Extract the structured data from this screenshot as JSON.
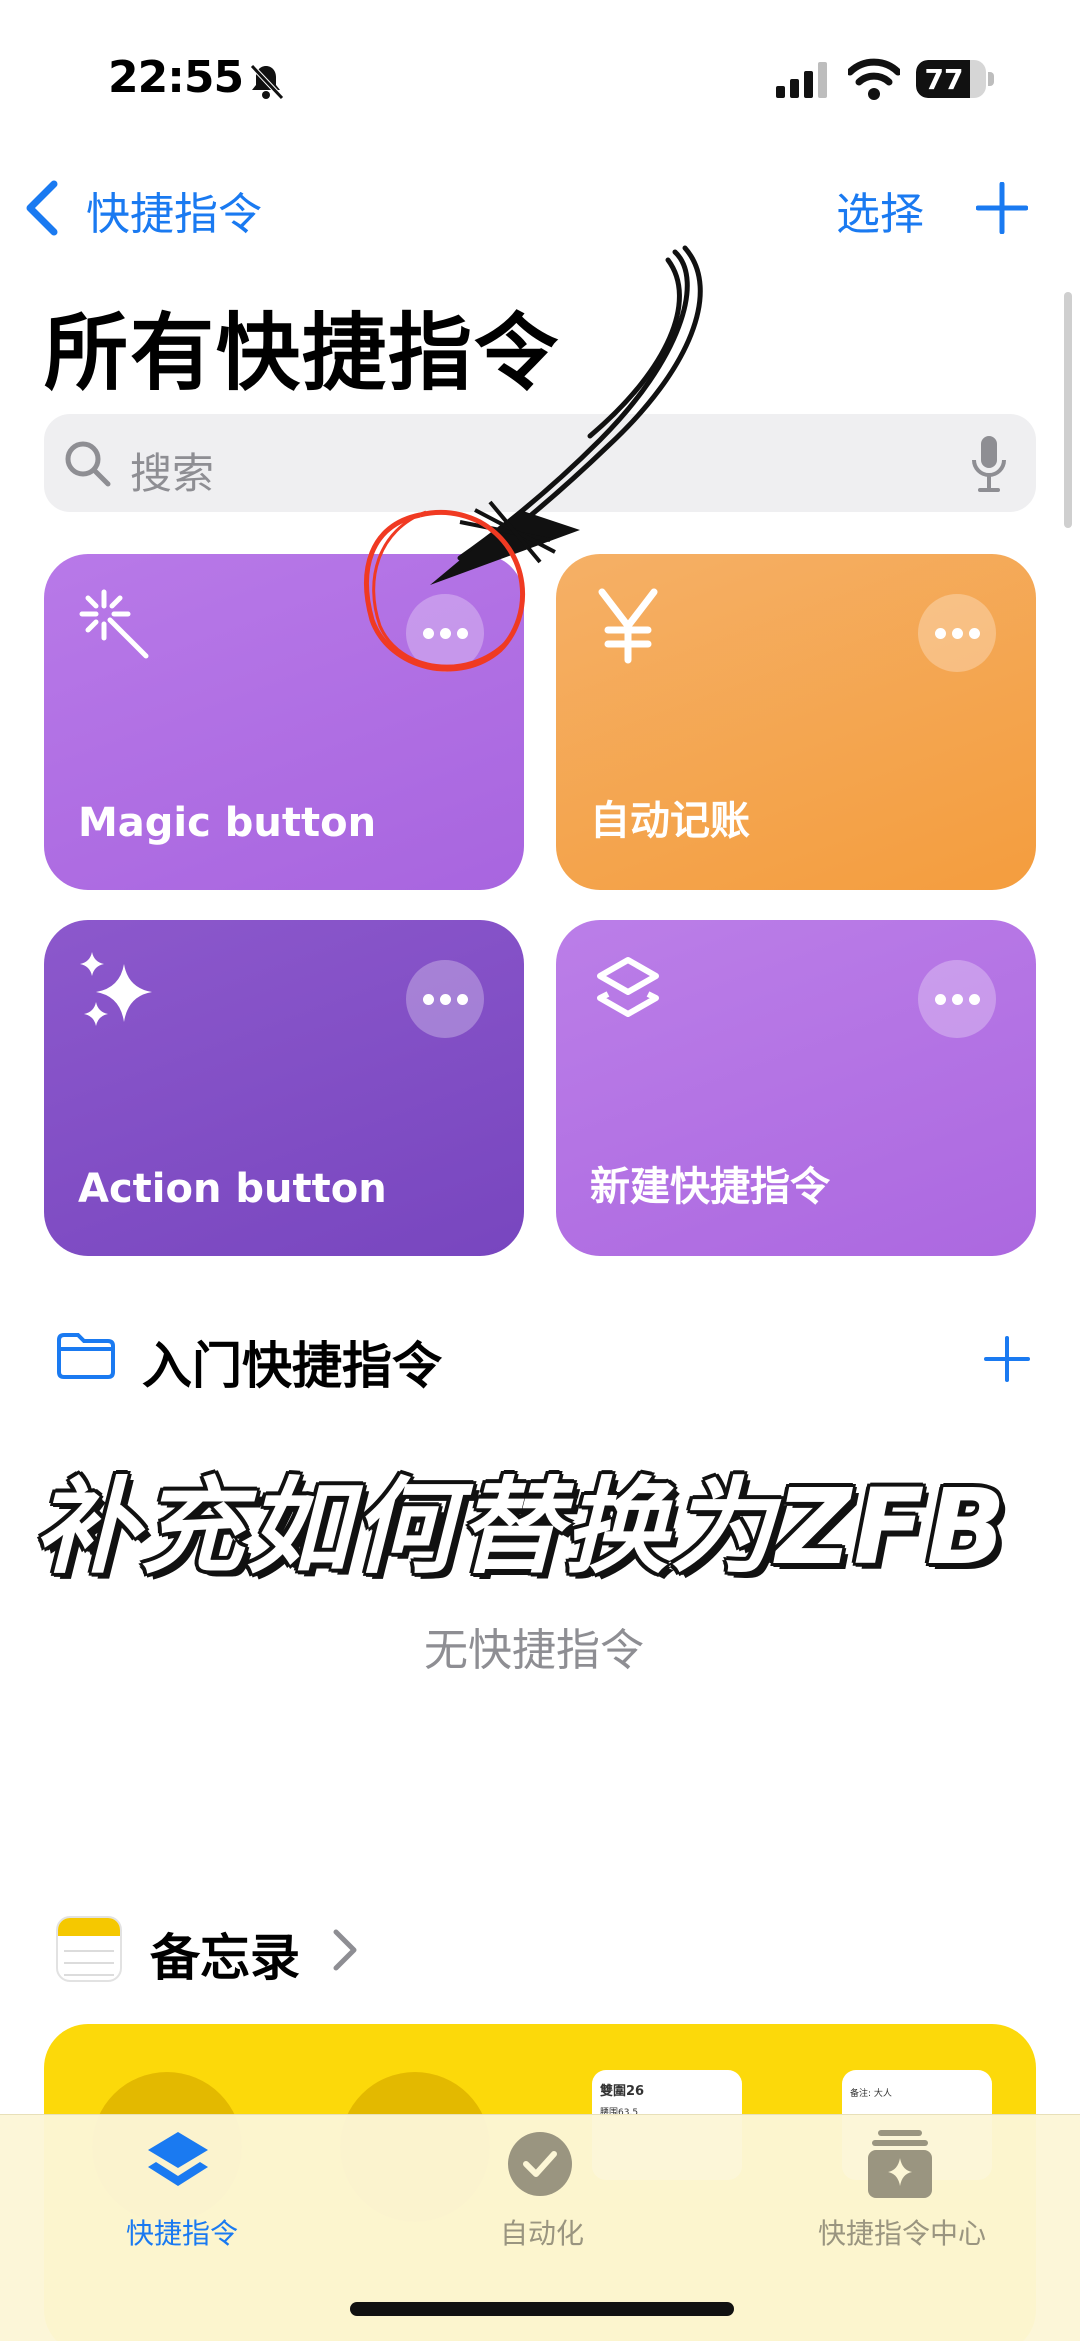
{
  "status_bar": {
    "time": "22:55",
    "battery": "77",
    "battery_level": 0.77
  },
  "nav": {
    "back_label": "快捷指令",
    "select_label": "选择"
  },
  "page": {
    "title": "所有快捷指令"
  },
  "search": {
    "placeholder": "搜索"
  },
  "shortcuts": [
    {
      "label": "Magic button",
      "icon": "magic-wand-icon",
      "color": "#b070e3"
    },
    {
      "label": "自动记账",
      "icon": "yen-icon",
      "color": "#f5a54e"
    },
    {
      "label": "Action button",
      "icon": "sparkles-icon",
      "color": "#8250c6"
    },
    {
      "label": "新建快捷指令",
      "icon": "shortcuts-layers-icon",
      "color": "#b475e4"
    }
  ],
  "folder": {
    "title": "入门快捷指令",
    "empty_text": "无快捷指令"
  },
  "overlay": {
    "text": "补充如何替换为ZFB"
  },
  "notes_section": {
    "title": "备忘录",
    "mini_notes": [
      {
        "title": "雙圍26",
        "row": "腰围63.5"
      },
      {
        "title": "",
        "row": "备注: 大人"
      }
    ]
  },
  "tabbar": {
    "tabs": [
      {
        "label": "快捷指令",
        "active": true
      },
      {
        "label": "自动化",
        "active": false
      },
      {
        "label": "快捷指令中心",
        "active": false
      }
    ]
  },
  "colors": {
    "accent": "#1a7af1",
    "annotation_red": "#f03a22"
  }
}
